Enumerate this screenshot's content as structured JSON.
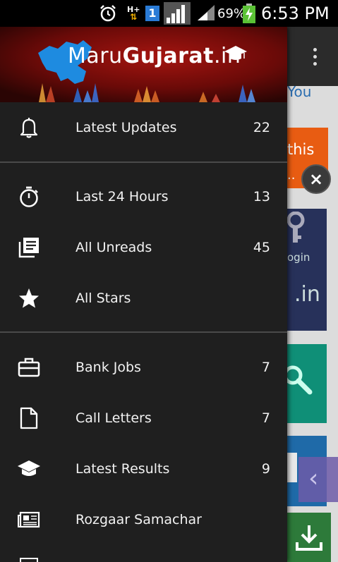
{
  "status_bar": {
    "network_type": "H+",
    "sim_slot": "1",
    "battery_percent": "69%",
    "time": "6:53 PM"
  },
  "drawer": {
    "brand_prefix": "Maru",
    "brand_name": "Gujarat",
    "brand_suffix": ".in",
    "sections": [
      {
        "items": [
          {
            "label": "Latest Updates",
            "count": "22",
            "icon": "bell-icon"
          }
        ]
      },
      {
        "items": [
          {
            "label": "Last 24 Hours",
            "count": "13",
            "icon": "stopwatch-icon"
          },
          {
            "label": "All Unreads",
            "count": "45",
            "icon": "library-books-icon"
          },
          {
            "label": "All Stars",
            "count": "",
            "icon": "star-icon"
          }
        ]
      },
      {
        "items": [
          {
            "label": "Bank Jobs",
            "count": "7",
            "icon": "briefcase-icon"
          },
          {
            "label": "Call Letters",
            "count": "7",
            "icon": "document-icon"
          },
          {
            "label": "Latest Results",
            "count": "9",
            "icon": "graduation-cap-icon"
          },
          {
            "label": "Rozgaar Samachar",
            "count": "",
            "icon": "newspaper-icon"
          }
        ]
      }
    ]
  },
  "background_app": {
    "fragment_you": "You",
    "fragment_this": "this",
    "fragment_ellipsis": "..",
    "fragment_login": "ogin",
    "fragment_in": ".in"
  }
}
